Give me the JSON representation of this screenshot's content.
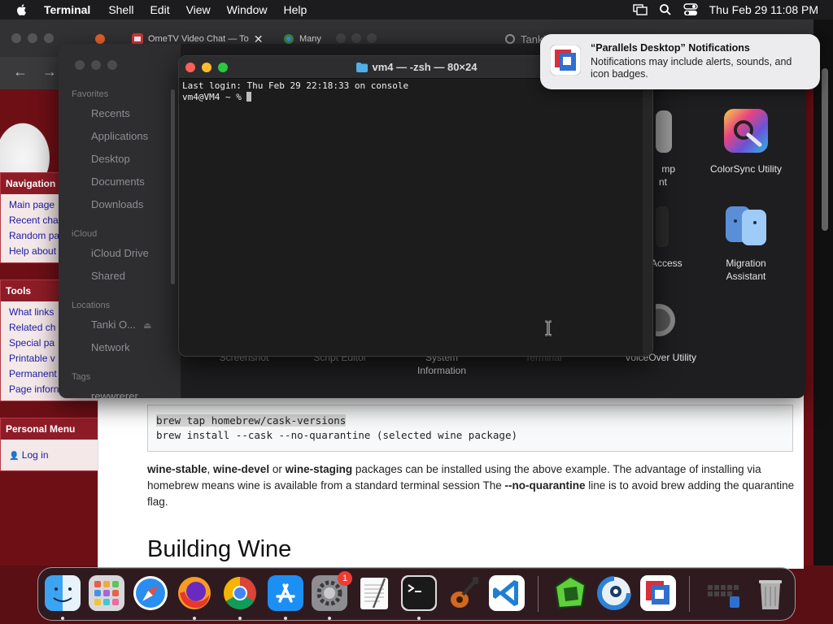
{
  "menubar": {
    "app_name": "Terminal",
    "items": [
      "Shell",
      "Edit",
      "View",
      "Window",
      "Help"
    ],
    "clock": "Thu Feb 29  11:08 PM"
  },
  "browser": {
    "tabs": [
      {
        "label": "OmeTV Video Chat — To"
      },
      {
        "label": "Many"
      }
    ],
    "background_title": "Tanki Online"
  },
  "wiki": {
    "navigation": {
      "title": "Navigation",
      "links": [
        "Main page",
        "Recent cha",
        "Random pa",
        "Help about"
      ]
    },
    "tools": {
      "title": "Tools",
      "links": [
        "What links",
        "Related ch",
        "Special pa",
        "Printable v",
        "Permanent",
        "Page inforn"
      ]
    },
    "personal": {
      "title": "Personal Menu",
      "login": "Log in"
    },
    "code": {
      "line1": "brew tap homebrew/cask-versions",
      "line2": "brew install --cask --no-quarantine (selected wine package)"
    },
    "paragraph": {
      "b1": "wine-stable",
      "t1": ", ",
      "b2": "wine-devel",
      "t2": " or ",
      "b3": "wine-staging",
      "t3": " packages can be installed using the above example. The advantage of installing via homebrew means wine is available from a standard terminal session The ",
      "b4": "--no-quarantine",
      "t4": " line is to avoid brew adding the quarantine flag."
    },
    "heading": "Building Wine"
  },
  "finder": {
    "favorites_label": "Favorites",
    "favorites": [
      "Recents",
      "Applications",
      "Desktop",
      "Documents",
      "Downloads"
    ],
    "icloud_label": "iCloud",
    "icloud": [
      "iCloud Drive",
      "Shared"
    ],
    "locations_label": "Locations",
    "locations": [
      "Tanki O...",
      "Network"
    ],
    "tags_label": "Tags",
    "tags": [
      "rewwrerer"
    ],
    "apps": [
      {
        "label": "ColorSync Utility"
      },
      {
        "label": "Migration\nAssistant"
      }
    ],
    "partial_labels": {
      "digital_color_meter_a": "mp",
      "digital_color_meter_b": "nt",
      "keychain": "Access",
      "screenshot": "Screenshot",
      "script_editor": "Script Editor",
      "system_information": "System\nInformation",
      "terminal": "Terminal",
      "voiceover": "VoiceOver Utility"
    }
  },
  "terminal": {
    "title": "vm4 — -zsh — 80×24",
    "line1": "Last login: Thu Feb 29 22:18:33 on console",
    "prompt": "vm4@VM4 ~ % "
  },
  "notification": {
    "title": "“Parallels Desktop” Notifications",
    "body": "Notifications may include alerts, sounds, and icon badges."
  },
  "dock": {
    "apps": [
      "Finder",
      "Launchpad",
      "Safari",
      "Firefox",
      "Chrome",
      "App Store",
      "System Settings",
      "TextEdit",
      "Terminal",
      "GarageBand",
      "Visual Studio Code",
      "Tanki Online",
      "Parallels Client",
      "Parallels Desktop",
      "Downloads",
      "Trash"
    ],
    "settings_badge": "1"
  },
  "colors": {
    "wiki_maroon": "#8e1c27",
    "menubar": "#1c1c1e",
    "badge_red": "#f03b32"
  }
}
